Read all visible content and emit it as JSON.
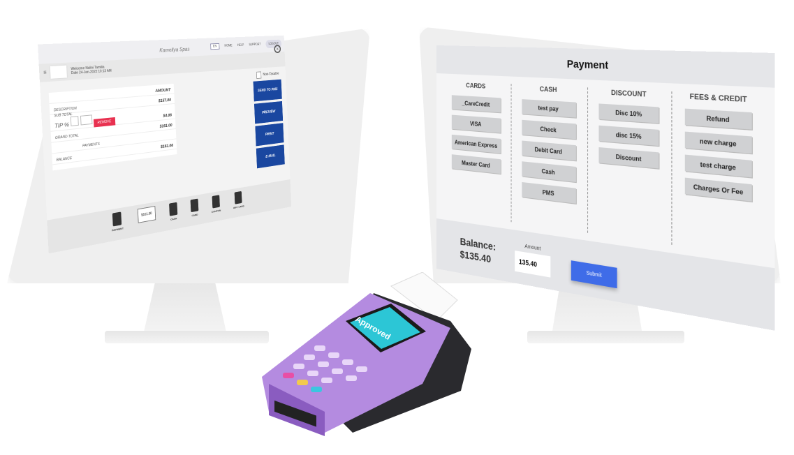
{
  "left_screen": {
    "topbar": {
      "language": "EN",
      "home": "HOME",
      "help": "HELP",
      "support": "SUPPORT",
      "logout": "LOGOUT"
    },
    "header": {
      "business_name": "Kamellya Spas",
      "welcome": "Welcome Nalini Tamilia",
      "date": "Date 24-Jan-2022 10:13 AM"
    },
    "non_taxable": "Non-Taxable",
    "summary": {
      "amount_header": "AMOUNT",
      "description_label": "DESCRIPTION",
      "description_value": "$157.00",
      "subtotal_label": "SUB TOTAL",
      "tip_label": "TIP %",
      "remove": "REMOVE",
      "tip_value": "$4.06",
      "grand_total_label": "GRAND TOTAL",
      "grand_total_value": "$161.00",
      "payments_label": "PAYMENTS",
      "balance_label": "BALANCE",
      "balance_value": "$161.06"
    },
    "actions": [
      "SEND TO PMS",
      "PREVIEW",
      "PRINT",
      "E-MAIL"
    ],
    "footer": {
      "items": [
        "PAYMENT",
        "CASH",
        "CARD",
        "COUPON",
        "GIFT CARD"
      ],
      "amount_box": "$161.00"
    }
  },
  "right_screen": {
    "title": "Payment",
    "columns": [
      {
        "heading": "CARDS",
        "buttons": [
          "_CareCredit",
          "VISA",
          "American Express",
          "Master Card"
        ]
      },
      {
        "heading": "CASH",
        "buttons": [
          "test pay",
          "Check",
          "Debit Card",
          "Cash",
          "PMS"
        ]
      },
      {
        "heading": "DISCOUNT",
        "buttons": [
          "Disc 10%",
          "disc 15%",
          "Discount"
        ]
      },
      {
        "heading": "FEES & CREDIT",
        "buttons": [
          "Refund",
          "new charge",
          "test charge",
          "Charges Or Fee"
        ]
      }
    ],
    "balance_label": "Balance:",
    "balance_value": "$135.40",
    "amount_label": "Amount",
    "amount_value": "135.40",
    "submit": "Submit"
  },
  "terminal": {
    "screen_text": "Approved",
    "body_color": "#b48be0",
    "screen_color": "#2cc6d6"
  }
}
